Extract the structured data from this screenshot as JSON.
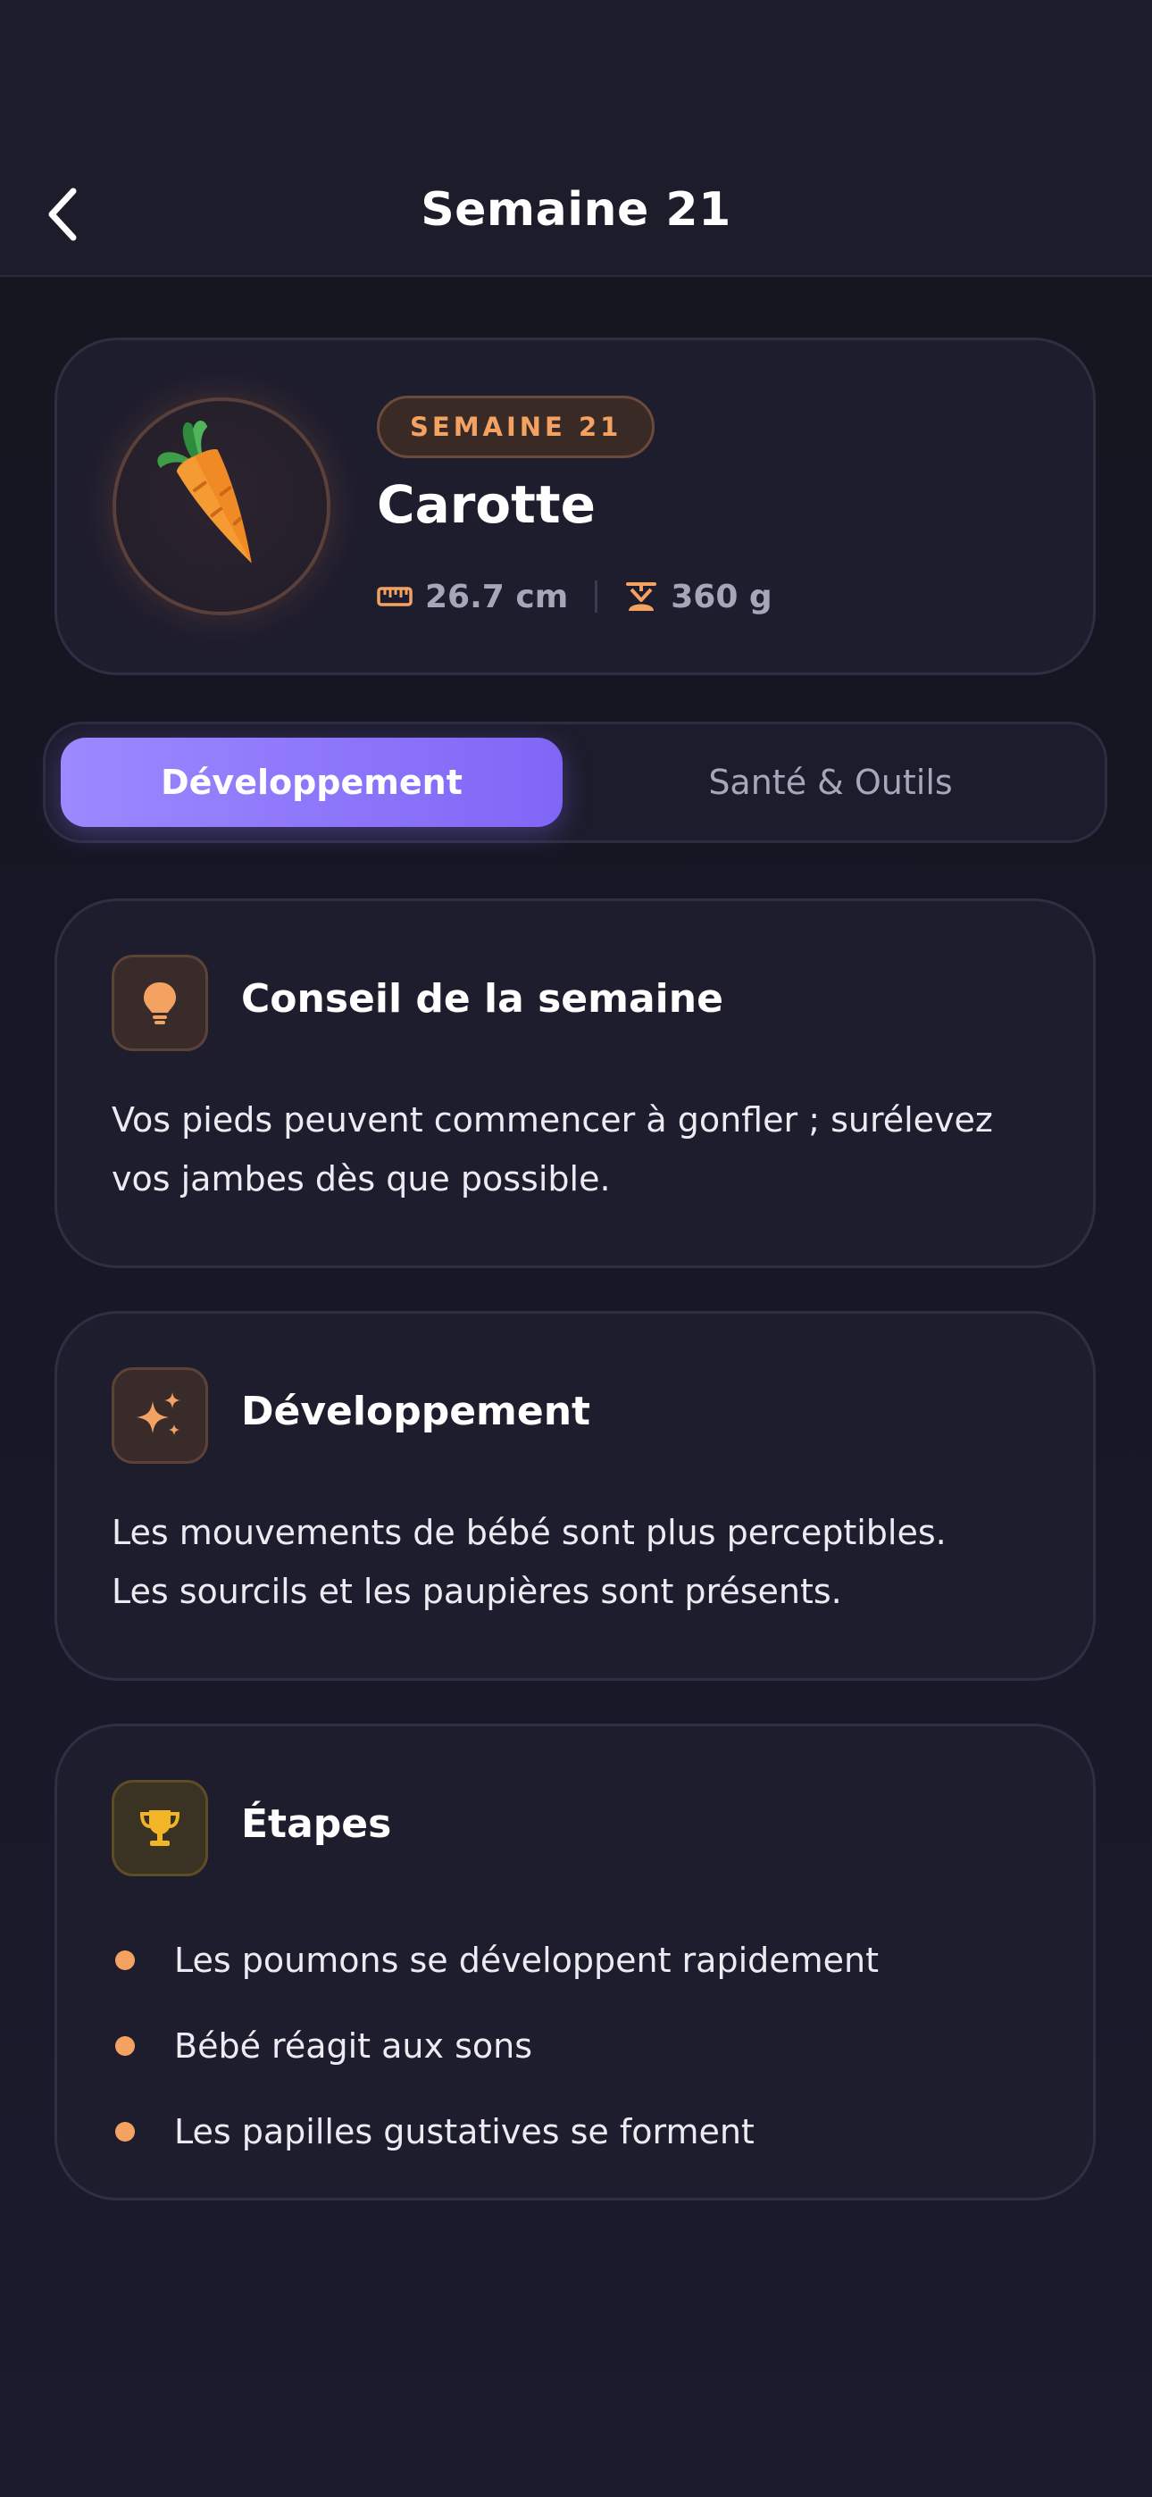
{
  "header": {
    "title": "Semaine 21",
    "back_icon": "chevron-left-icon"
  },
  "hero": {
    "badge": "SEMAINE 21",
    "fruit_name": "Carotte",
    "fruit_icon": "carrot-icon",
    "length": "26.7 cm",
    "length_icon": "ruler-icon",
    "weight": "360 g",
    "weight_icon": "scale-icon"
  },
  "tabs": [
    {
      "label": "Développement",
      "active": true
    },
    {
      "label": "Santé & Outils",
      "active": false
    }
  ],
  "cards": {
    "tip": {
      "icon": "lightbulb-icon",
      "title": "Conseil de la semaine",
      "lines": [
        "Vos pieds peuvent commencer à gonfler ; surélevez",
        "vos jambes dès que possible."
      ]
    },
    "development": {
      "icon": "sparkles-icon",
      "title": "Développement",
      "lines": [
        "Les mouvements de bébé sont plus perceptibles.",
        "Les sourcils et les paupières sont présents."
      ]
    },
    "milestones": {
      "icon": "trophy-icon",
      "title": "Étapes",
      "items": [
        "Les poumons se développent rapidement",
        "Bébé réagit aux sons",
        "Les papilles gustatives se forment"
      ]
    }
  },
  "colors": {
    "accent_orange": "#f4a262",
    "accent_purple": "#8b73fb",
    "background": "#171726",
    "card": "#1e1d2e"
  }
}
